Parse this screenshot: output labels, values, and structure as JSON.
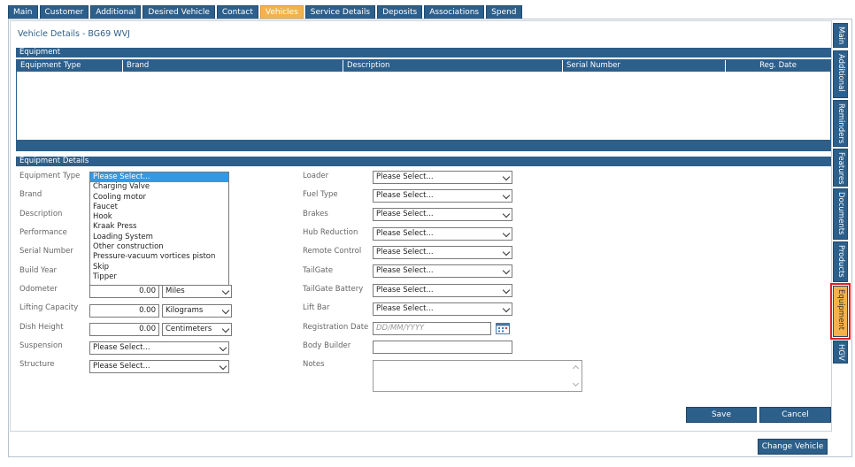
{
  "top_tabs": [
    {
      "label": "Main"
    },
    {
      "label": "Customer"
    },
    {
      "label": "Additional"
    },
    {
      "label": "Desired Vehicle"
    },
    {
      "label": "Contact"
    },
    {
      "label": "Vehicles",
      "active": true
    },
    {
      "label": "Service Details"
    },
    {
      "label": "Deposits"
    },
    {
      "label": "Associations"
    },
    {
      "label": "Spend"
    }
  ],
  "page_title": "Vehicle Details - BG69 WVJ",
  "equipment_section": {
    "title": "Equipment",
    "columns": [
      "Equipment Type",
      "Brand",
      "Description",
      "Serial Number",
      "Reg. Date"
    ]
  },
  "details_section": {
    "title": "Equipment Details"
  },
  "left_labels": {
    "equipment_type": "Equipment Type",
    "brand": "Brand",
    "description": "Description",
    "performance": "Performance",
    "serial_number": "Serial Number",
    "build_year": "Build Year",
    "odometer": "Odometer",
    "lifting_capacity": "Lifting Capacity",
    "dish_height": "Dish Height",
    "suspension": "Suspension",
    "structure": "Structure"
  },
  "equipment_type_dropdown": {
    "selected": "Please Select...",
    "options": [
      "Please Select...",
      "Charging Valve",
      "Cooling motor",
      "Faucet",
      "Hook",
      "Kraak Press",
      "Loading System",
      "Other construction",
      "Pressure-vacuum vortices piston",
      "Skip",
      "Tipper"
    ]
  },
  "odometer": {
    "value": "0.00",
    "unit": "Miles"
  },
  "lifting_capacity": {
    "value": "0.00",
    "unit": "Kilograms"
  },
  "dish_height": {
    "value": "0.00",
    "unit": "Centimeters"
  },
  "suspension": {
    "value": "Please Select..."
  },
  "structure": {
    "value": "Please Select..."
  },
  "right_labels": {
    "loader": "Loader",
    "fuel_type": "Fuel Type",
    "brakes": "Brakes",
    "hub_reduction": "Hub Reduction",
    "remote_control": "Remote Control",
    "tailgate": "TailGate",
    "tailgate_battery": "TailGate Battery",
    "lift_bar": "Lift Bar",
    "registration_date": "Registration Date",
    "body_builder": "Body Builder",
    "notes": "Notes"
  },
  "right_selects": {
    "loader": "Please Select...",
    "fuel_type": "Please Select...",
    "brakes": "Please Select...",
    "hub_reduction": "Please Select...",
    "remote_control": "Please Select...",
    "tailgate": "Please Select...",
    "tailgate_battery": "Please Select...",
    "lift_bar": "Please Select..."
  },
  "registration_date": {
    "placeholder": "DD/MM/YYYY"
  },
  "buttons": {
    "save": "Save",
    "cancel": "Cancel",
    "change_vehicle": "Change Vehicle"
  },
  "side_tabs": [
    {
      "label": "Main"
    },
    {
      "label": "Additional"
    },
    {
      "label": "Reminders"
    },
    {
      "label": "Features"
    },
    {
      "label": "Documents"
    },
    {
      "label": "Products"
    },
    {
      "label": "Equipment",
      "active": true,
      "highlight": "#e02020"
    },
    {
      "label": "HGV"
    }
  ],
  "colors": {
    "primary": "#2d5f8b",
    "active_tab": "#f2b24d",
    "highlight_border": "#e02020",
    "selected_option": "#3399e5"
  }
}
